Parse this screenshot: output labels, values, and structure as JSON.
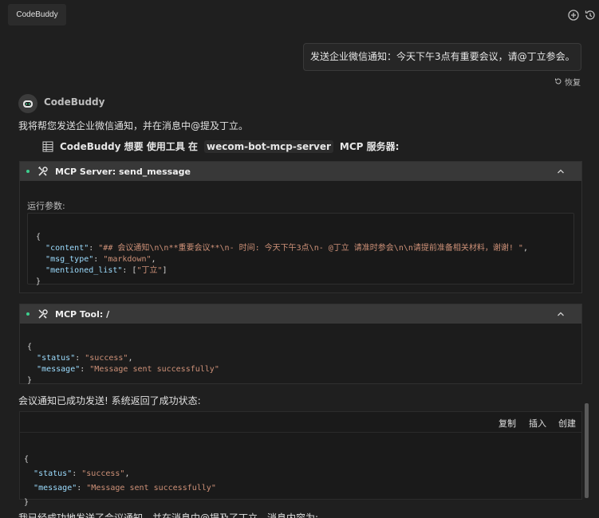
{
  "app": {
    "title": "CodeBuddy"
  },
  "user_message": {
    "text": "发送企业微信通知：今天下午3点有重要会议，请@丁立参会。",
    "restore_label": "恢复"
  },
  "assistant": {
    "name": "CodeBuddy",
    "intro": "我将帮您发送企业微信通知，并在消息中@提及丁立。",
    "tool_request": {
      "prefix": "CodeBuddy 想要 使用工具 在",
      "server": "wecom-bot-mcp-server",
      "suffix": "MCP 服务器:"
    }
  },
  "server_panel": {
    "title": "MCP Server: send_message",
    "params_label": "运行参数:",
    "code": {
      "open": "{",
      "line1": {
        "key": "\"content\"",
        "colon": ": ",
        "value": "\"## 会议通知\\n\\n**重要会议**\\n- 时间: 今天下午3点\\n- @丁立 请准时参会\\n\\n请提前准备相关材料，谢谢! \"",
        "tail": ","
      },
      "line2": {
        "key": "\"msg_type\"",
        "colon": ": ",
        "value": "\"markdown\"",
        "tail": ","
      },
      "line3": {
        "key": "\"mentioned_list\"",
        "colon": ": ",
        "pre": "[",
        "value": "\"丁立\"",
        "tail": "]"
      },
      "close": "}"
    }
  },
  "tool_panel": {
    "title": "MCP Tool: /",
    "code": {
      "open": "{",
      "line1": {
        "key": "\"status\"",
        "colon": ": ",
        "value": "\"success\"",
        "tail": ","
      },
      "line2": {
        "key": "\"message\"",
        "colon": ": ",
        "value": "\"Message sent successfully\""
      },
      "close": "}"
    }
  },
  "result_text": "会议通知已成功发送! 系统返回了成功状态:",
  "result_code": {
    "toolbar": {
      "copy": "复制",
      "insert": "插入",
      "create": "创建"
    },
    "open": "{",
    "line1": {
      "key": "\"status\"",
      "colon": ": ",
      "value": "\"success\"",
      "tail": ","
    },
    "line2": {
      "key": "\"message\"",
      "colon": ": ",
      "value": "\"Message sent successfully\""
    },
    "close": "}"
  },
  "trailing_text": "我已经成功地发送了会议通知，并在消息中@提及了丁立，消息内容为:",
  "colors": {
    "accent_green": "#3ecf8e",
    "string": "#ce9178",
    "key": "#9cdcfe",
    "background": "#1f1f1f"
  },
  "icons": [
    "add-chat-icon",
    "history-icon",
    "restore-icon",
    "codebuddy-avatar-icon",
    "table-icon",
    "tools-icon",
    "chevron-up-icon"
  ]
}
